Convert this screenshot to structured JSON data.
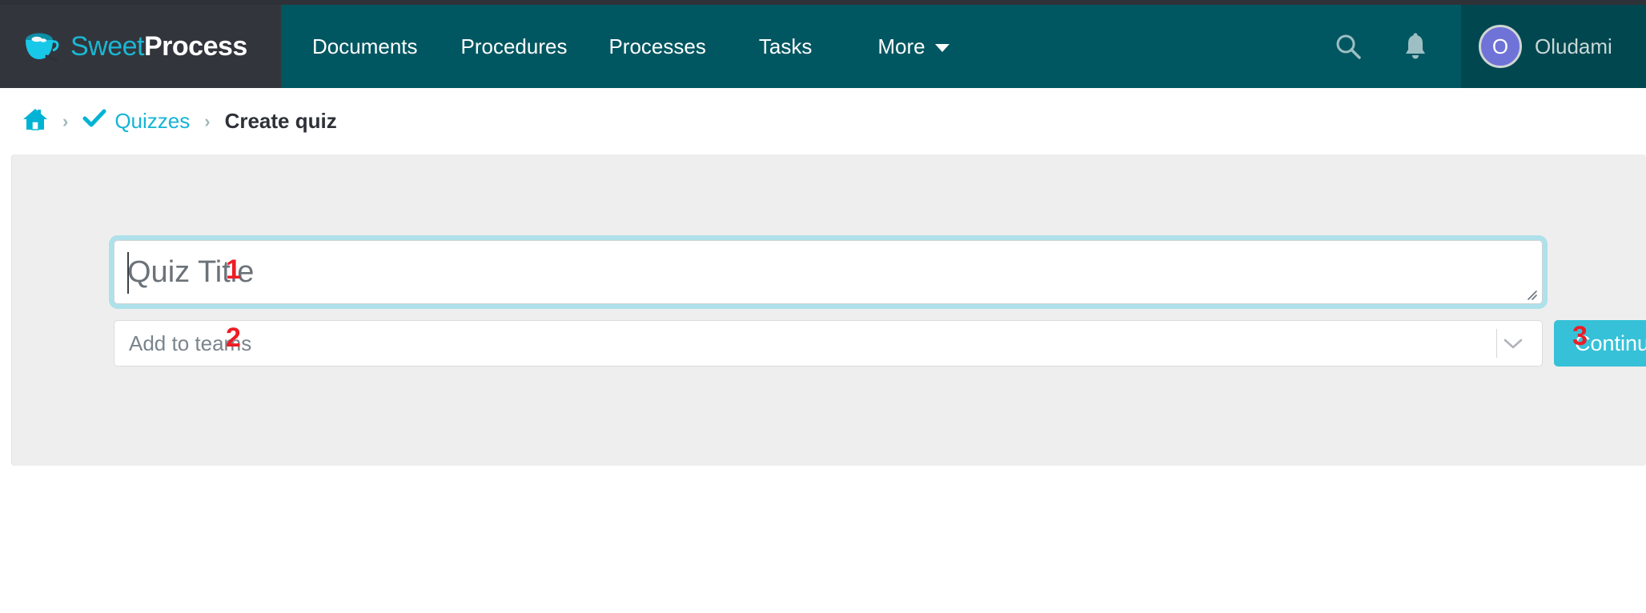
{
  "brand": {
    "name_light": "Sweet",
    "name_bold": "Process",
    "logo_icon": "coffee-cup-icon"
  },
  "navbar": {
    "links": [
      {
        "label": "Documents",
        "key": "documents"
      },
      {
        "label": "Procedures",
        "key": "procedures"
      },
      {
        "label": "Processes",
        "key": "processes"
      },
      {
        "label": "Tasks",
        "key": "tasks"
      },
      {
        "label": "More",
        "key": "more",
        "has_chevron": true
      }
    ],
    "icons": [
      {
        "name": "search-icon"
      },
      {
        "name": "notifications-bell-icon"
      }
    ],
    "user": {
      "avatar_initial": "O",
      "name": "Oludami"
    },
    "colors": {
      "bar": "#015761",
      "brand_panel": "#32363c",
      "user_panel": "#004750",
      "top_strip": "#2e3238"
    }
  },
  "breadcrumb": {
    "home_icon": "home-icon",
    "separator": "›",
    "items": [
      {
        "label": "Quizzes",
        "icon": "check-icon",
        "current": false
      },
      {
        "label": "Create quiz",
        "current": true
      }
    ],
    "link_color": "#13b5d4"
  },
  "form": {
    "title_field": {
      "value": "",
      "placeholder": "Quiz Title",
      "focused": true
    },
    "teams_field": {
      "value": "",
      "placeholder": "Add to teams",
      "arrow_icon": "chevron-down-icon"
    },
    "continue_button": {
      "label": "Continue",
      "color": "#36c1d8"
    }
  },
  "annotations": {
    "color": "#ee1c25",
    "markers": [
      {
        "number": "1",
        "target": "quiz-title-field"
      },
      {
        "number": "2",
        "target": "add-to-teams-select"
      },
      {
        "number": "3",
        "target": "continue-button"
      }
    ]
  }
}
